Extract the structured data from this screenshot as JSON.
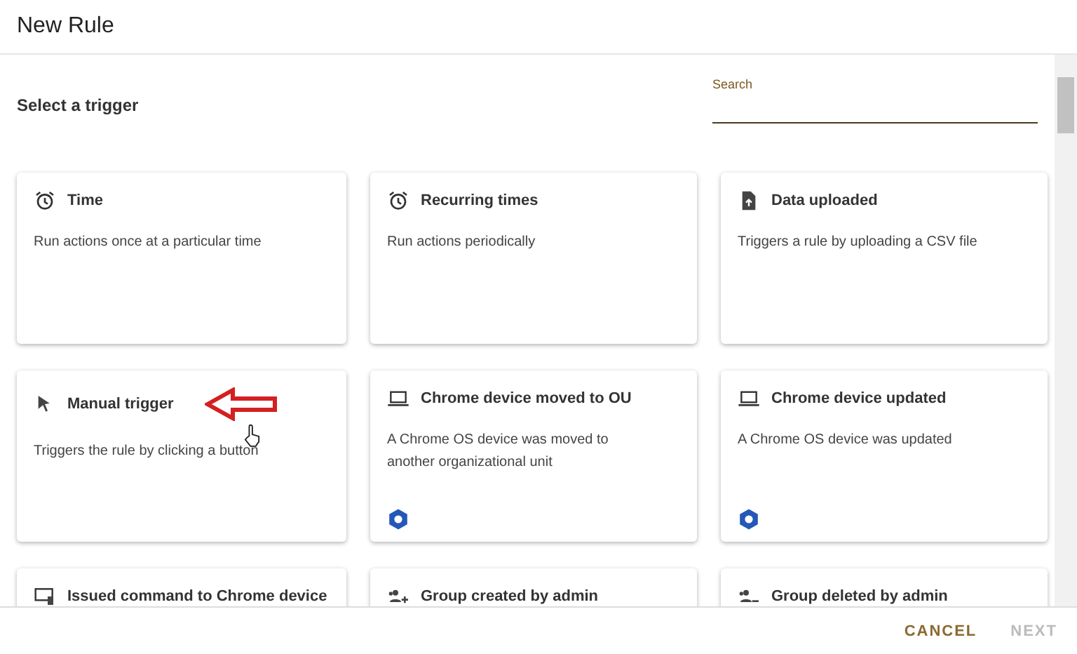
{
  "window": {
    "title": "New Rule"
  },
  "section_title": "Select a trigger",
  "search": {
    "label": "Search"
  },
  "cards": [
    {
      "kind": "alarm",
      "title": "Time",
      "description": "Run actions once at a particular time",
      "badge": false
    },
    {
      "kind": "alarm",
      "title": "Recurring times",
      "description": "Run actions periodically",
      "badge": false
    },
    {
      "kind": "upload",
      "title": "Data uploaded",
      "description": "Triggers a rule by uploading a CSV file",
      "badge": false
    },
    {
      "kind": "cursor",
      "title": "Manual trigger",
      "description": "Triggers the rule by clicking a button",
      "badge": false,
      "annotated": true
    },
    {
      "kind": "laptop",
      "title": "Chrome device moved to OU",
      "description": "A Chrome OS device was moved to another organizational unit",
      "badge": true
    },
    {
      "kind": "laptop",
      "title": "Chrome device updated",
      "description": "A Chrome OS device was updated",
      "badge": true
    },
    {
      "kind": "command",
      "title": "Issued command to Chrome device"
    },
    {
      "kind": "group-add",
      "title": "Group created by admin"
    },
    {
      "kind": "group-remove",
      "title": "Group deleted by admin"
    }
  ],
  "buttons": [
    {
      "label": "CANCEL",
      "disabled": false
    },
    {
      "label": "NEXT",
      "disabled": true
    }
  ]
}
